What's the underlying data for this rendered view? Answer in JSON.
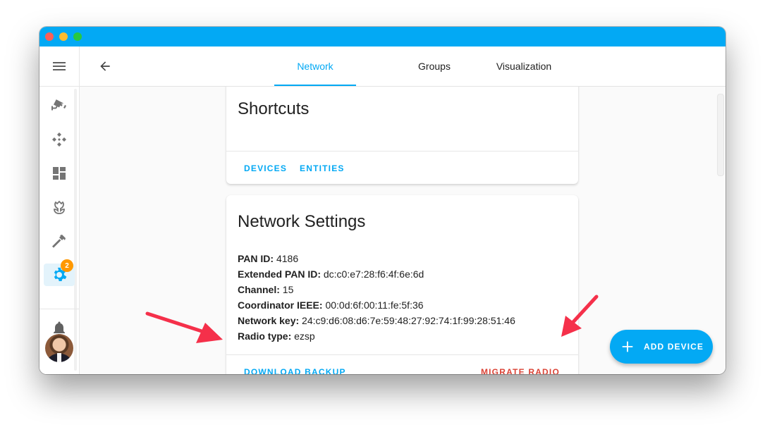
{
  "header": {
    "back_icon": "arrow-left-icon",
    "tabs": [
      {
        "label": "Network",
        "active": true
      },
      {
        "label": "Groups",
        "active": false
      },
      {
        "label": "Visualization",
        "active": false
      }
    ]
  },
  "sidebar": {
    "items": [
      {
        "icon": "menu-icon"
      },
      {
        "icon": "cctv-icon"
      },
      {
        "icon": "devices-icon"
      },
      {
        "icon": "dashboard-icon"
      },
      {
        "icon": "flower-tulip-icon"
      },
      {
        "icon": "hammer-icon"
      },
      {
        "icon": "gear-icon",
        "badge": "2",
        "selected": true
      },
      {
        "icon": "bell-icon"
      },
      {
        "icon": "avatar"
      }
    ]
  },
  "shortcuts_card": {
    "title": "Shortcuts",
    "buttons": [
      "Devices",
      "Entities"
    ]
  },
  "network_card": {
    "title": "Network Settings",
    "rows": [
      {
        "label": "PAN ID:",
        "value": "4186"
      },
      {
        "label": "Extended PAN ID:",
        "value": "dc:c0:e7:28:f6:4f:6e:6d"
      },
      {
        "label": "Channel:",
        "value": "15"
      },
      {
        "label": "Coordinator IEEE:",
        "value": "00:0d:6f:00:11:fe:5f:36"
      },
      {
        "label": "Network key:",
        "value": "24:c9:d6:08:d6:7e:59:48:27:92:74:1f:99:28:51:46"
      },
      {
        "label": "Radio type:",
        "value": "ezsp"
      }
    ],
    "download_backup": "Download Backup",
    "migrate_radio": "Migrate Radio"
  },
  "fab": {
    "label": "ADD DEVICE",
    "icon": "plus-icon"
  },
  "colors": {
    "accent": "#03a9f4",
    "danger": "#db4437",
    "badge": "#ff9800",
    "annotation_arrow": "#f5304a"
  }
}
